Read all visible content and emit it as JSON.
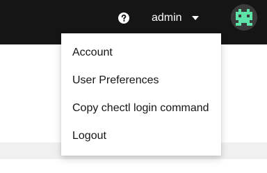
{
  "header": {
    "help_icon": "question-circle-icon",
    "username": "admin",
    "caret_icon": "caret-down-icon",
    "avatar_icon": "avatar-identicon"
  },
  "user_menu": {
    "items": [
      {
        "label": "Account"
      },
      {
        "label": "User Preferences"
      },
      {
        "label": "Copy chectl login command"
      },
      {
        "label": "Logout"
      }
    ]
  },
  "colors": {
    "header_bg": "#151515",
    "header_text": "#ffffff",
    "avatar_accent": "#5ee3a8",
    "menu_text": "#151515",
    "page_band": "#f0f0f0"
  }
}
